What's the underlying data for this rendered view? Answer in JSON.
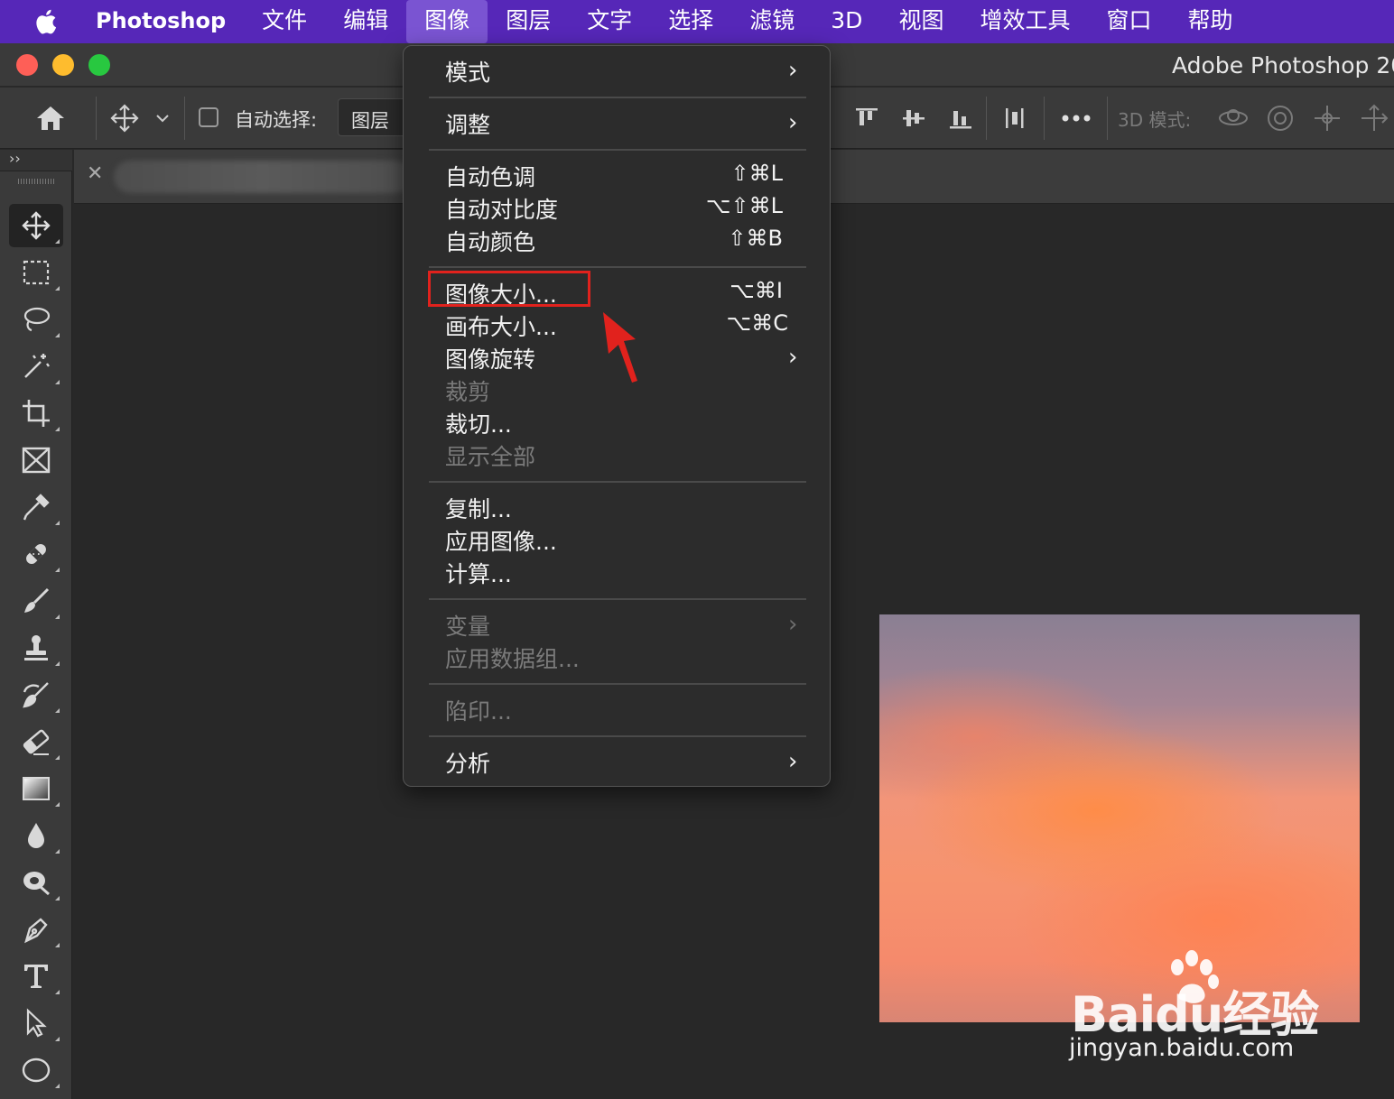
{
  "menubar": {
    "app_name": "Photoshop",
    "items": [
      "文件",
      "编辑",
      "图像",
      "图层",
      "文字",
      "选择",
      "滤镜",
      "3D",
      "视图",
      "增效工具",
      "窗口",
      "帮助"
    ],
    "active": "图像"
  },
  "titlebar": {
    "title": "Adobe Photoshop 20"
  },
  "options": {
    "auto_select_label": "自动选择:",
    "auto_select_value": "图层",
    "mode_3d_label": "3D 模式:",
    "auto_select_checked": false
  },
  "tools": {
    "selected": "move-tool",
    "items": [
      "move-tool",
      "marquee-tool",
      "lasso-tool",
      "magic-wand-tool",
      "crop-tool",
      "frame-tool",
      "eyedropper-tool",
      "healing-tool",
      "brush-tool",
      "stamp-tool",
      "history-brush-tool",
      "eraser-tool",
      "gradient-tool",
      "blur-tool",
      "dodge-tool",
      "pen-tool",
      "type-tool",
      "path-select-tool",
      "ellipse-tool"
    ]
  },
  "image_menu": {
    "mode": "模式",
    "adjust": "调整",
    "auto_tone": {
      "label": "自动色调",
      "shortcut": "⇧⌘L"
    },
    "auto_contrast": {
      "label": "自动对比度",
      "shortcut": "⌥⇧⌘L"
    },
    "auto_color": {
      "label": "自动颜色",
      "shortcut": "⇧⌘B"
    },
    "image_size": {
      "label": "图像大小...",
      "shortcut": "⌥⌘I"
    },
    "canvas_size": {
      "label": "画布大小...",
      "shortcut": "⌥⌘C"
    },
    "image_rotation": "图像旋转",
    "crop": "裁剪",
    "trim": "裁切...",
    "reveal_all": "显示全部",
    "duplicate": "复制...",
    "apply_image": "应用图像...",
    "calculations": "计算...",
    "variables": "变量",
    "apply_data_set": "应用数据组...",
    "trap": "陷印...",
    "analysis": "分析"
  },
  "watermark": {
    "brand": "Bai",
    "brand_tail": "du经验",
    "url": "jingyan.baidu.com"
  },
  "colors": {
    "menubar": "#5627b8",
    "highlight": "#e1221d"
  }
}
